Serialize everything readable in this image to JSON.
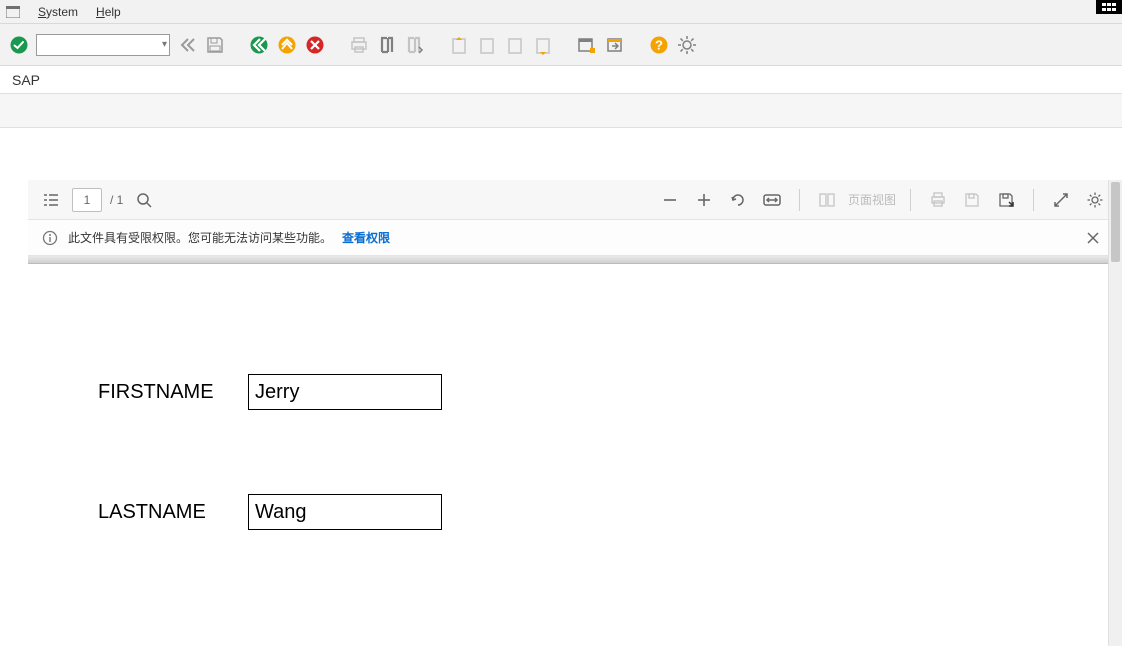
{
  "menu": {
    "system": "System",
    "help": "Help"
  },
  "sap": {
    "title": "SAP",
    "command": "",
    "icons": {
      "enter": "enter",
      "back": "back",
      "save": "save",
      "exit": "exit",
      "up": "up",
      "cancel": "cancel",
      "print": "print",
      "find": "find",
      "findnext": "find-next",
      "first": "first",
      "prev": "prev",
      "next": "next",
      "last": "last",
      "newwin": "new-window",
      "shortcut": "shortcut",
      "helpico": "help",
      "customize": "customize"
    }
  },
  "pdf": {
    "page_current": "1",
    "page_total": "/ 1",
    "page_view_label": "页面视图",
    "message": {
      "text": "此文件具有受限权限。您可能无法访问某些功能。",
      "link": "查看权限"
    }
  },
  "form": {
    "first_label": "FIRSTNAME",
    "first_value": "Jerry",
    "last_label": "LASTNAME",
    "last_value": "Wang"
  }
}
